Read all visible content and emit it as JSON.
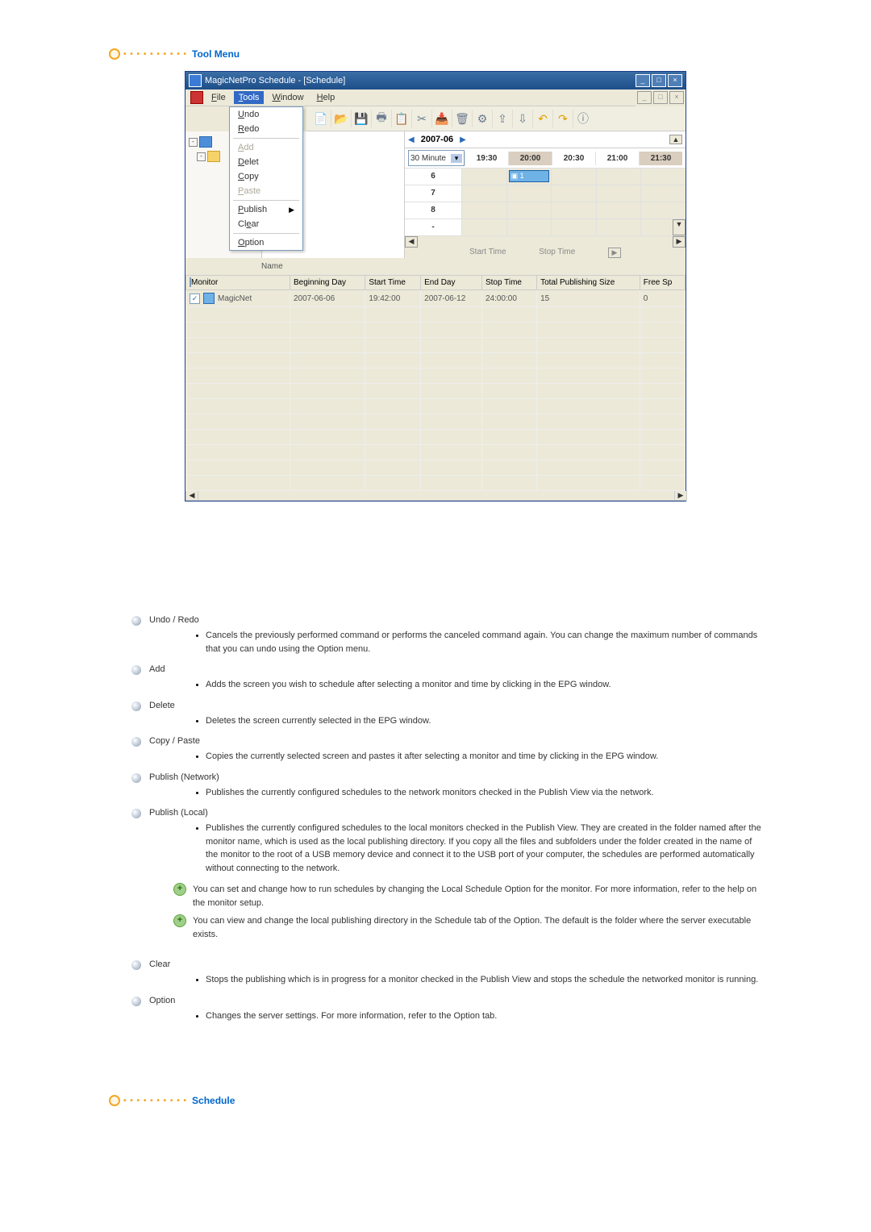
{
  "section1_title": "Tool Menu",
  "section2_title": "Schedule",
  "window": {
    "title": "MagicNetPro Schedule - [Schedule]",
    "menubar": [
      "File",
      "Tools",
      "Window",
      "Help"
    ],
    "dropdown": {
      "undo": "Undo",
      "redo": "Redo",
      "add": "Add",
      "delet": "Delet",
      "copy": "Copy",
      "paste": "Paste",
      "publish": "Publish",
      "clear": "Clear",
      "option": "Option"
    },
    "t_letter": "T",
    "month_label": "2007-06",
    "time_select": "30 Minute",
    "time_cells": [
      "19:30",
      "20:00",
      "20:30",
      "21:00",
      "21:30"
    ],
    "sched_rows": [
      "6",
      "7",
      "8",
      "-"
    ],
    "sched_block": "1",
    "null_left": "Name",
    "mid_start": "Start Time",
    "mid_stop": "Stop Time",
    "table": {
      "headers": [
        "Monitor",
        "Beginning Day",
        "Start Time",
        "End Day",
        "Stop Time",
        "Total Publishing Size",
        "Free Sp"
      ],
      "row": {
        "monitor": "MagicNet",
        "begin": "2007-06-06",
        "start": "19:42:00",
        "end": "2007-06-12",
        "stop": "24:00:00",
        "size": "15",
        "free": "0"
      }
    }
  },
  "doc": {
    "undo": {
      "title": "Undo / Redo",
      "body": "Cancels the previously performed command or performs the canceled command again. You can change the maximum number of commands that you can undo using the Option menu."
    },
    "add": {
      "title": "Add",
      "body": "Adds the screen you wish to schedule after selecting a monitor and time by clicking in the EPG window."
    },
    "delete": {
      "title": "Delete",
      "body": "Deletes the screen currently selected in the EPG window."
    },
    "copy": {
      "title": "Copy / Paste",
      "body": "Copies the currently selected screen and pastes it after selecting a monitor and time by clicking in the EPG window."
    },
    "pubnet": {
      "title": "Publish (Network)",
      "body": "Publishes the currently configured schedules to the network monitors checked in the Publish View via the network."
    },
    "publoc": {
      "title": "Publish (Local)",
      "body": "Publishes the currently configured schedules to the local monitors checked in the Publish View. They are created in the folder named after the monitor name, which is used as the local publishing directory. If you copy all the files and subfolders under the folder created in the name of the monitor to the root of a USB memory device and connect it to the USB port of your computer, the schedules are performed automatically without connecting to the network.",
      "note1": "You can set and change how to run schedules by changing the Local Schedule Option for the monitor. For more information, refer to the help on the monitor setup.",
      "note2": "You can view and change the local publishing directory in the Schedule tab of the Option. The default is the folder where the server executable exists."
    },
    "clear": {
      "title": "Clear",
      "body": "Stops the publishing which is in progress for a monitor checked in the Publish View and stops the schedule the networked monitor is running."
    },
    "option": {
      "title": "Option",
      "body": "Changes the server settings. For more information, refer to the Option tab."
    }
  }
}
